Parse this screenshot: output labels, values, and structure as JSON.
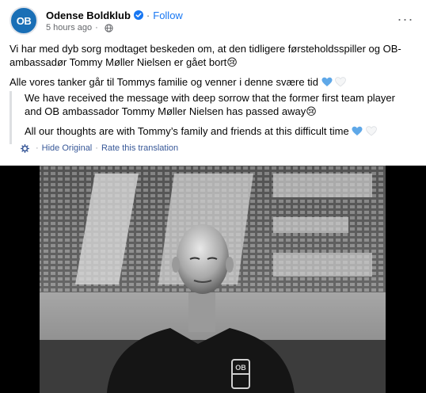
{
  "post": {
    "page_name": "Odense Boldklub",
    "avatar_text": "OB",
    "follow_label": "Follow",
    "separator": "·",
    "timestamp": "5 hours ago",
    "paragraph1": "Vi har med dyb sorg modtaget beskeden om, at den tidligere førsteholdsspiller og OB-ambassadør Tommy Møller Nielsen er gået bort😢",
    "paragraph2": "Alle vores tanker går til Tommys familie og venner i denne svære tid",
    "translation": {
      "paragraph1": "We have received the message with deep sorrow that the former first team player and OB ambassador Tommy Møller Nielsen has passed away😢",
      "paragraph2": "All our thoughts are with Tommy’s family and friends at this difficult time",
      "hide_original_label": "Hide Original",
      "separator": "·",
      "rate_label": "Rate this translation"
    },
    "photo_logo_text": "OB"
  },
  "colors": {
    "link_blue": "#1877f2",
    "translation_link": "#385898",
    "secondary_text": "#65676b",
    "heart_blue": "#5fa8e8",
    "avatar_blue": "#1a6fb6"
  }
}
